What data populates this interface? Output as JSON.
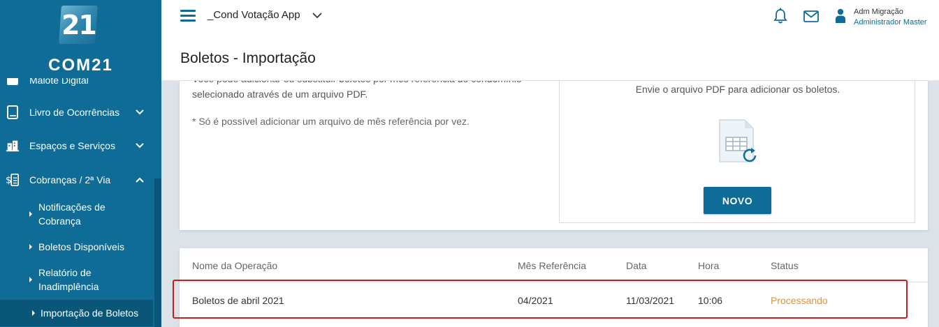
{
  "sidebar": {
    "logo_mark": "21",
    "logo_text": "COM21",
    "items": [
      {
        "label": "Malote Digital",
        "icon": "mailbag-icon"
      },
      {
        "label": "Livro de Ocorrências",
        "icon": "book-icon"
      },
      {
        "label": "Espaços e Serviços",
        "icon": "building-icon"
      },
      {
        "label": "Cobranças / 2ª Via",
        "icon": "billing-icon"
      }
    ],
    "sub_items": [
      {
        "label": "Notificações de Cobrança"
      },
      {
        "label": "Boletos Disponíveis"
      },
      {
        "label": "Relatório de Inadimplência"
      },
      {
        "label": "Importação de Boletos"
      }
    ]
  },
  "header": {
    "app_name": "_Cond Votação App",
    "user_name": "Adm Migração",
    "user_role": "Administrador Master"
  },
  "page": {
    "title": "Boletos - Importação"
  },
  "intro": {
    "description": "Você pode adicionar ou substituir boletos por mês referência do condomínio selecionado através de um arquivo PDF.",
    "note": "* Só é possível adicionar um arquivo de mês referência por vez."
  },
  "upload": {
    "instruction": "Envie o arquivo PDF para adicionar os boletos.",
    "button_label": "NOVO"
  },
  "table": {
    "columns": [
      "Nome da Operação",
      "Mês Referência",
      "Data",
      "Hora",
      "Status"
    ],
    "rows": [
      {
        "name": "Boletos de abril 2021",
        "month": "04/2021",
        "date": "11/03/2021",
        "time": "10:06",
        "status": "Processando"
      }
    ]
  },
  "colors": {
    "primary": "#0e6c96",
    "status_processing": "#e3912b",
    "highlight": "#d0191b"
  }
}
